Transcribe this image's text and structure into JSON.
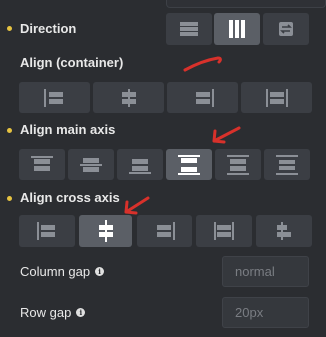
{
  "direction": {
    "label": "Direction",
    "options": [
      "row",
      "column",
      "reverse"
    ],
    "selected": "column"
  },
  "align_container": {
    "label": "Align (container)"
  },
  "align_main_axis": {
    "label": "Align main axis",
    "selected_index": 3
  },
  "align_cross_axis": {
    "label": "Align cross axis",
    "selected_index": 1
  },
  "column_gap": {
    "label": "Column gap",
    "info": "i",
    "placeholder": "normal"
  },
  "row_gap": {
    "label": "Row gap",
    "info": "i",
    "placeholder": "20px"
  },
  "colors": {
    "accent_dot": "#e6c341",
    "annotation": "#d8312b",
    "active": "#5b5f66"
  }
}
